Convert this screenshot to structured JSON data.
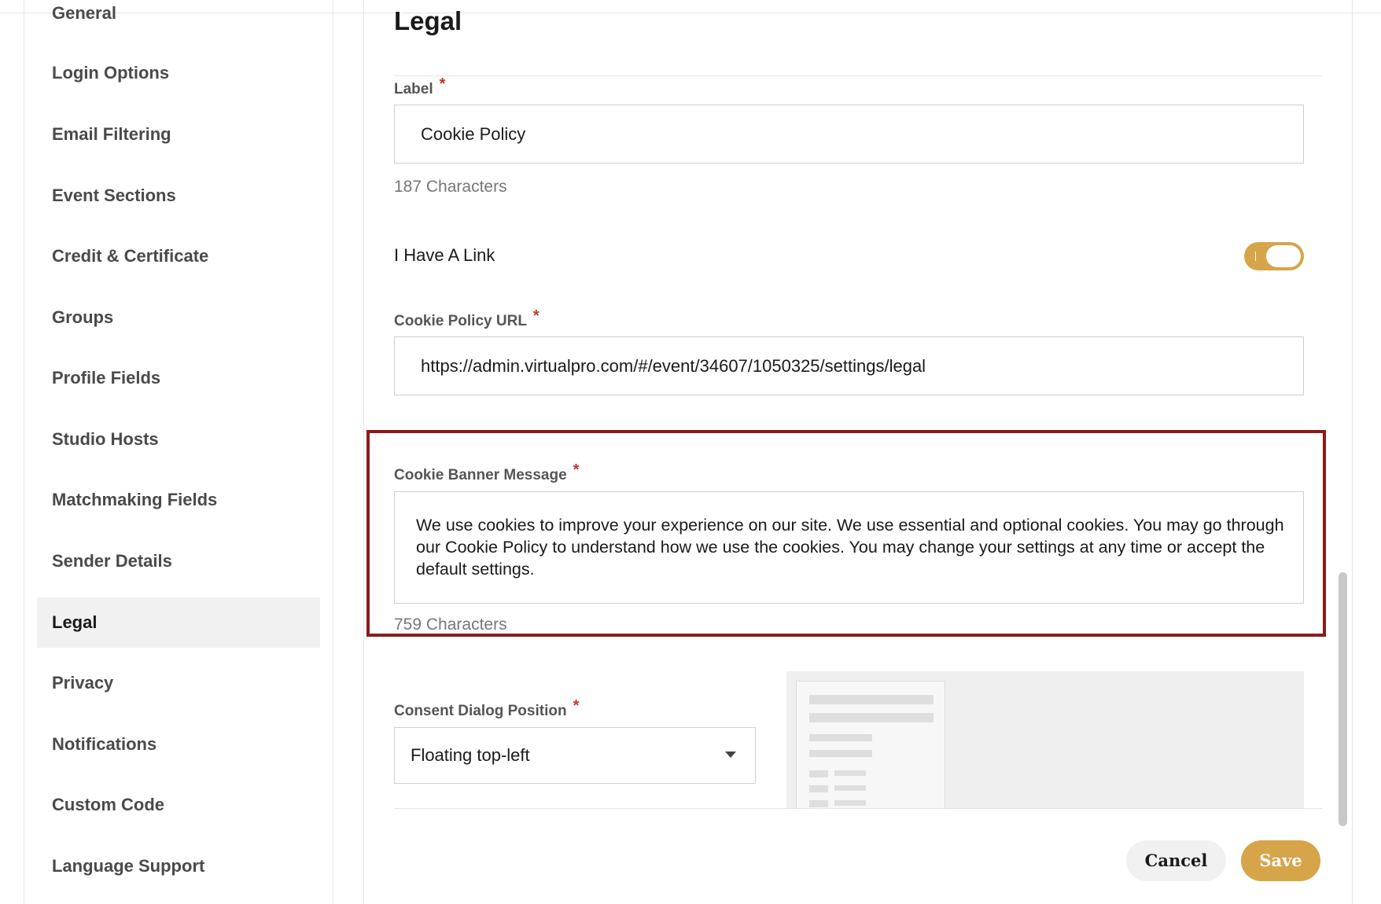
{
  "sidebar": {
    "items": [
      {
        "label": "General"
      },
      {
        "label": "Login Options"
      },
      {
        "label": "Email Filtering"
      },
      {
        "label": "Event Sections"
      },
      {
        "label": "Credit & Certificate"
      },
      {
        "label": "Groups"
      },
      {
        "label": "Profile Fields"
      },
      {
        "label": "Studio Hosts"
      },
      {
        "label": "Matchmaking Fields"
      },
      {
        "label": "Sender Details"
      },
      {
        "label": "Legal",
        "active": true
      },
      {
        "label": "Privacy"
      },
      {
        "label": "Notifications"
      },
      {
        "label": "Custom Code"
      },
      {
        "label": "Language Support"
      }
    ]
  },
  "main": {
    "title": "Legal",
    "label_field": {
      "label": "Label",
      "required": "*",
      "value": "Cookie Policy",
      "char_count": "187 Characters"
    },
    "link_toggle": {
      "label": "I Have A Link",
      "on": true
    },
    "url_field": {
      "label": "Cookie Policy URL",
      "required": "*",
      "value": "https://admin.virtualpro.com/#/event/34607/1050325/settings/legal"
    },
    "banner_field": {
      "label": "Cookie Banner Message",
      "required": "*",
      "value": "We use cookies to improve your experience on our site. We use essential and optional cookies. You may go through our Cookie Policy to understand how we use the cookies. You may change your settings at any time or accept the default settings.",
      "char_count": "759 Characters"
    },
    "position_field": {
      "label": "Consent Dialog Position",
      "required": "*",
      "value": "Floating top-left"
    },
    "actions": {
      "cancel": "Cancel",
      "save": "Save"
    }
  },
  "colors": {
    "accent": "#d6a54a",
    "highlight_border": "#8b1a1a",
    "required": "#c0392b",
    "active_nav_bg": "#f1f1f1"
  },
  "icons": {
    "select_caret": "caret-down-icon"
  }
}
